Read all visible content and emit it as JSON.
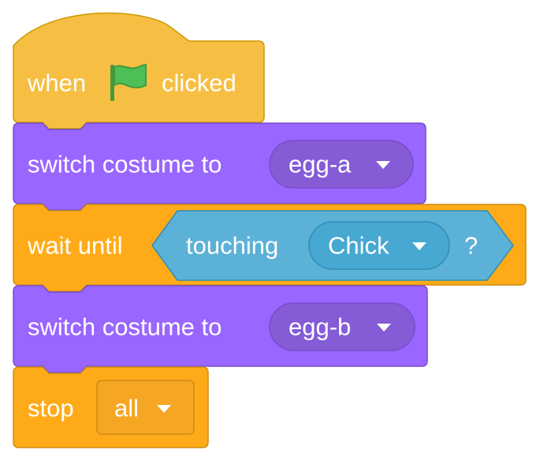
{
  "script": {
    "hat": {
      "word_before": "when",
      "icon": "green-flag-icon",
      "word_after": "clicked",
      "color": "#FFBF00"
    },
    "switch_costume_1": {
      "label": "switch costume to",
      "value": "egg-a",
      "color": "#9966FF"
    },
    "wait_until": {
      "label": "wait until",
      "sensing": {
        "label": "touching",
        "value": "Chick",
        "suffix": "?",
        "color": "#5CB1D6"
      },
      "color": "#FFAB19"
    },
    "switch_costume_2": {
      "label": "switch costume to",
      "value": "egg-b",
      "color": "#9966FF"
    },
    "stop": {
      "label": "stop",
      "value": "all",
      "color": "#FFAB19"
    }
  }
}
